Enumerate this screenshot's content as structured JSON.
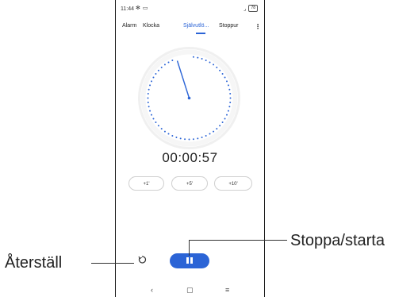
{
  "status_bar": {
    "time": "11:44",
    "battery": "78"
  },
  "tabs": [
    {
      "label": "Alarm"
    },
    {
      "label": "Klocka"
    },
    {
      "label": "Självutlö..."
    },
    {
      "label": "Stoppur"
    }
  ],
  "active_tab": "Självutlö...",
  "timer": {
    "display": "00:00:57"
  },
  "adjust_buttons": [
    {
      "label": "+1'"
    },
    {
      "label": "+5'"
    },
    {
      "label": "+10'"
    }
  ],
  "callouts": {
    "reset": "Återställ",
    "start_stop": "Stoppa/starta"
  },
  "navbar": {
    "back": "‹",
    "home": "▢",
    "recents": "≡"
  },
  "colors": {
    "accent": "#2b64d6"
  }
}
